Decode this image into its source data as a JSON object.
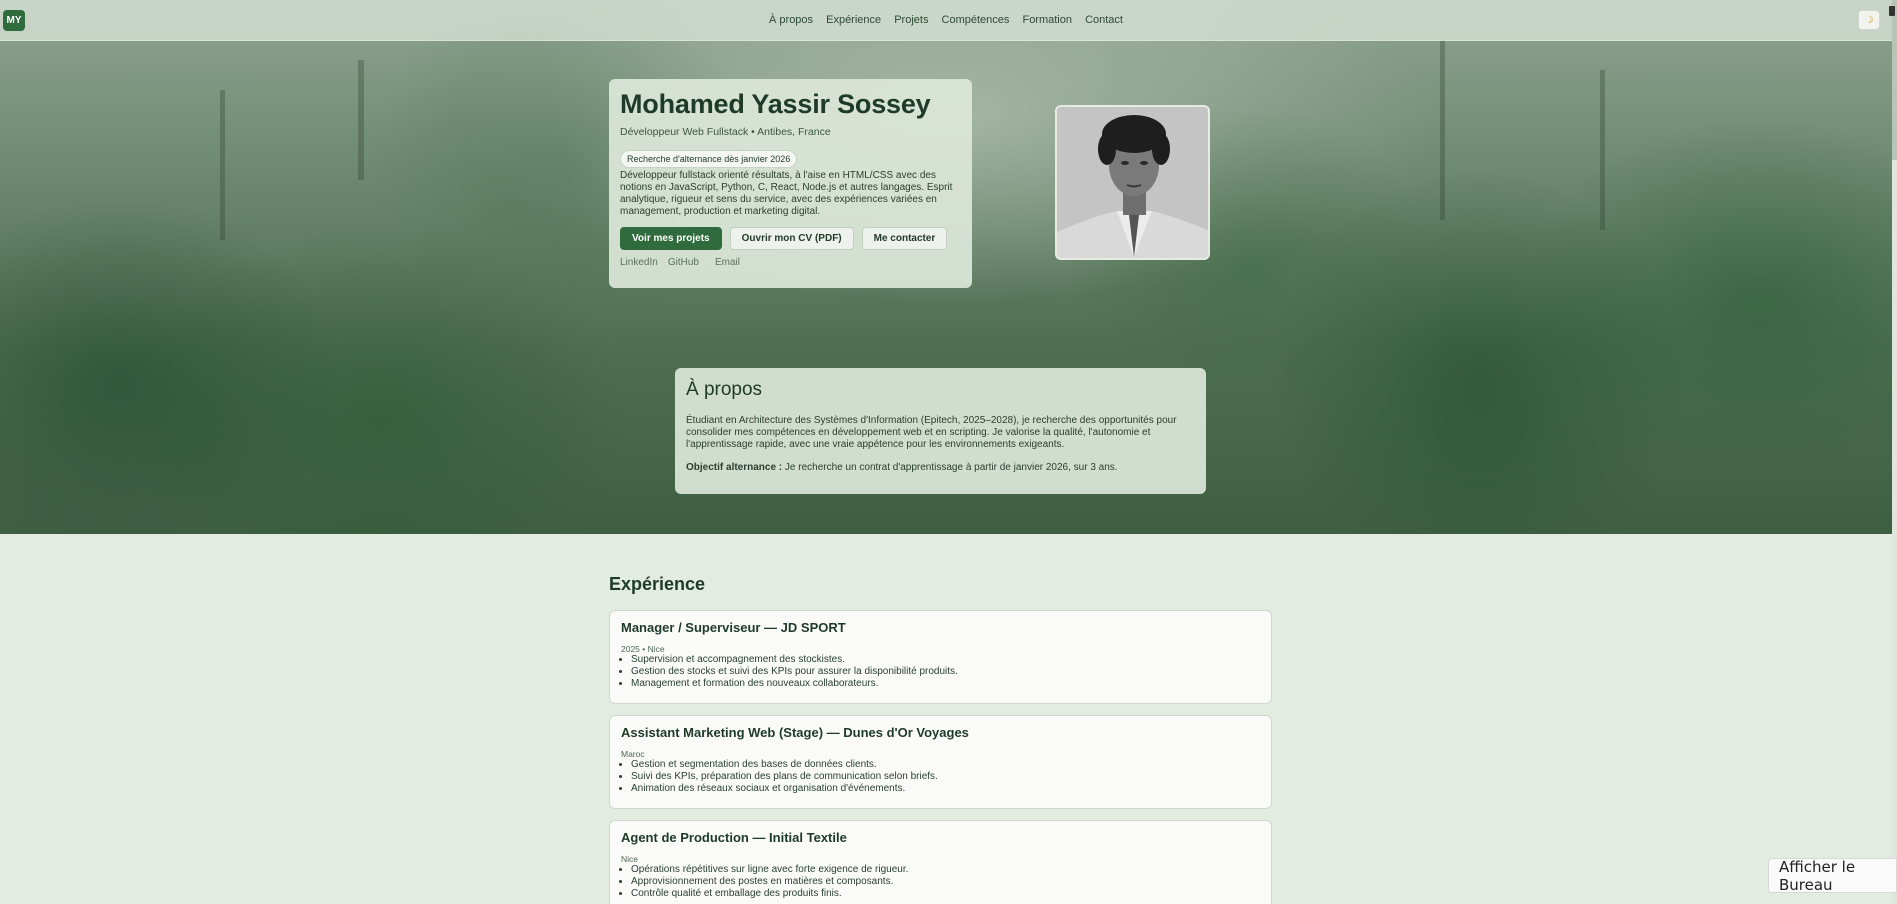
{
  "nav": {
    "logo": "MY",
    "links": [
      "À propos",
      "Expérience",
      "Projets",
      "Compétences",
      "Formation",
      "Contact"
    ],
    "theme_icon": "moon-icon"
  },
  "hero": {
    "name": "Mohamed Yassir Sossey",
    "role": "Développeur Web Fullstack • Antibes, France",
    "badge": "Recherche d'alternance dès janvier 2026",
    "description": "Développeur fullstack orienté résultats, à l'aise en HTML/CSS avec des notions en JavaScript, Python, C, React, Node.js et autres langages. Esprit analytique, rigueur et sens du service, avec des expériences variées en management, production et marketing digital.",
    "buttons": {
      "projects": "Voir mes projets",
      "cv": "Ouvrir mon CV (PDF)",
      "contact": "Me contacter"
    },
    "social": [
      "LinkedIn",
      "GitHub",
      "Email"
    ]
  },
  "about": {
    "title": "À propos",
    "text": "Étudiant en Architecture des Systèmes d'Information (Epitech, 2025–2028), je recherche des opportunités pour consolider mes compétences en développement web et en scripting. Je valorise la qualité, l'autonomie et l'apprentissage rapide, avec une vraie appétence pour les environnements exigeants.",
    "goal_label": "Objectif alternance :",
    "goal_text": " Je recherche un contrat d'apprentissage à partir de janvier 2026, sur 3 ans."
  },
  "experience": {
    "title": "Expérience",
    "items": [
      {
        "title": "Manager / Superviseur — JD SPORT",
        "meta": "2025 • Nice",
        "bullets": [
          "Supervision et accompagnement des stockistes.",
          "Gestion des stocks et suivi des KPIs pour assurer la disponibilité produits.",
          "Management et formation des nouveaux collaborateurs."
        ]
      },
      {
        "title": "Assistant Marketing Web (Stage) — Dunes d'Or Voyages",
        "meta": "Maroc",
        "bullets": [
          "Gestion et segmentation des bases de données clients.",
          "Suivi des KPIs, préparation des plans de communication selon briefs.",
          "Animation des réseaux sociaux et organisation d'événements."
        ]
      },
      {
        "title": "Agent de Production — Initial Textile",
        "meta": "Nice",
        "bullets": [
          "Opérations répétitives sur ligne avec forte exigence de rigueur.",
          "Approvisionnement des postes en matières et composants.",
          "Contrôle qualité et emballage des produits finis."
        ]
      }
    ]
  },
  "os": {
    "show_desktop": "Afficher le Bureau"
  },
  "colors": {
    "accent": "#2f6b3c",
    "page_bg": "#e3ece0",
    "card_bg": "#dbe6d8"
  }
}
